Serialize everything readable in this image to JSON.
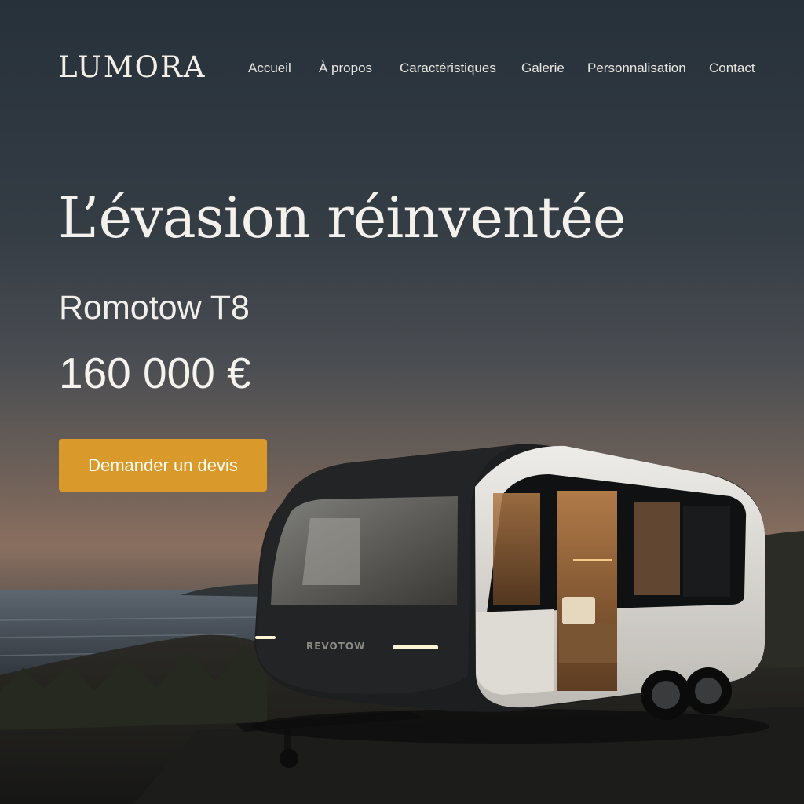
{
  "brand": {
    "logo": "LUMORA"
  },
  "nav": {
    "items": [
      {
        "label": "Accueil"
      },
      {
        "label": "À propos"
      },
      {
        "label": "Caractéristiques"
      },
      {
        "label": "Galerie"
      },
      {
        "label": "Personnalisation"
      },
      {
        "label": "Contact"
      }
    ]
  },
  "hero": {
    "title": "L’évasion réinventée",
    "model": "Romotow T8",
    "price": "160 000 €",
    "cta_label": "Demander un devis"
  },
  "trailer": {
    "badge": "REVOTOW"
  },
  "colors": {
    "accent": "#d99a2b",
    "text": "#f4f1ec",
    "sky_top": "#27313a",
    "sunset": "#8a6f5f"
  }
}
